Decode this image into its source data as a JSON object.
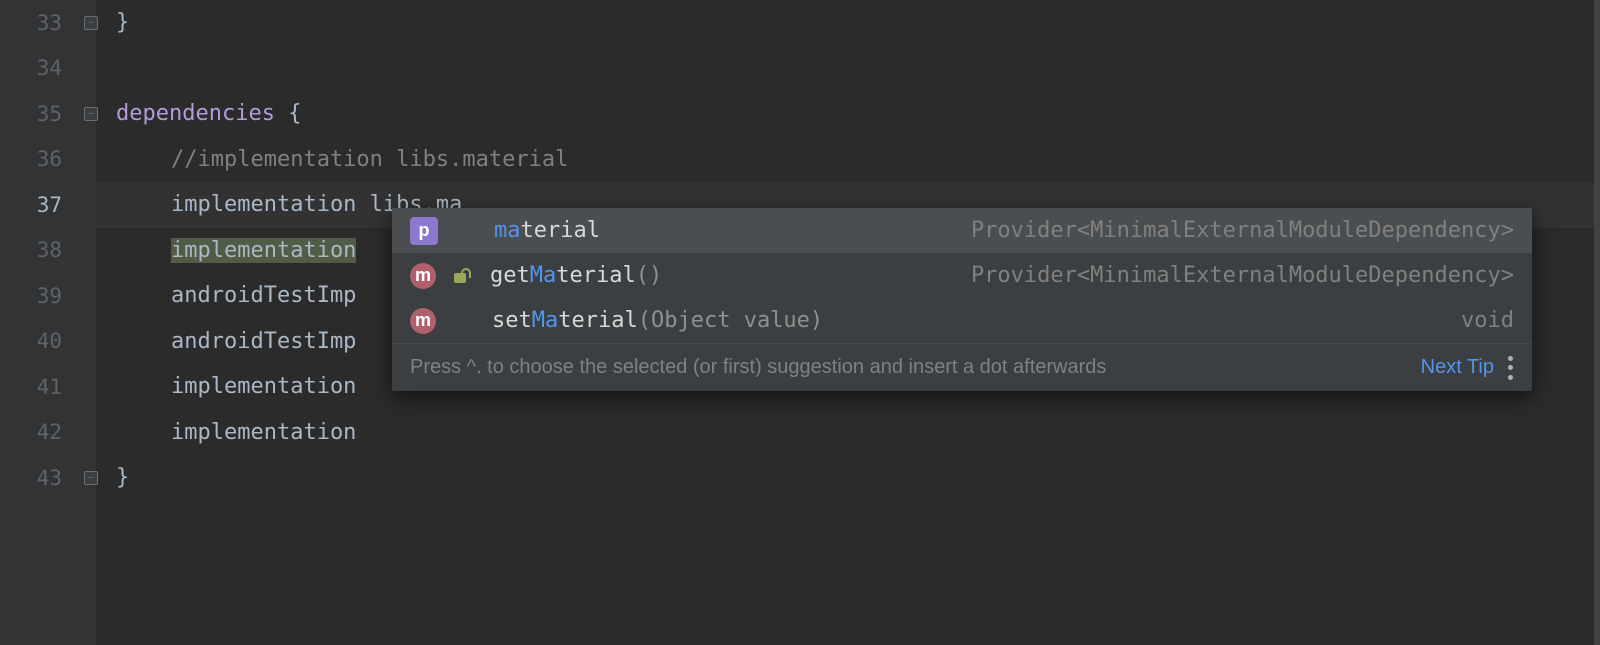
{
  "gutter": {
    "start": 33,
    "count": 11,
    "current": 37
  },
  "code": {
    "l33": {
      "brace": "}",
      "fold": "end"
    },
    "l34": {
      "empty": ""
    },
    "l35": {
      "block": "dependencies",
      "brace": " {",
      "fold": "start"
    },
    "l36": {
      "comment": "//implementation libs.material"
    },
    "l37": {
      "kw": "implementation",
      "arg": " libs.ma"
    },
    "l38": {
      "kw": "implementation"
    },
    "l39": {
      "kw": "androidTestImp"
    },
    "l40": {
      "kw": "androidTestImp"
    },
    "l41": {
      "kw": "implementation"
    },
    "l42": {
      "kw": "implementation"
    },
    "l43": {
      "brace": "}",
      "fold": "end"
    }
  },
  "popup": {
    "rows": [
      {
        "icon": "p",
        "match": "ma",
        "rest": "terial",
        "type": "Provider<MinimalExternalModuleDependency>",
        "selected": true
      },
      {
        "icon": "m",
        "lock": true,
        "pre": "get",
        "match": "Ma",
        "rest": "terial",
        "post": "()",
        "type": "Provider<MinimalExternalModuleDependency>"
      },
      {
        "icon": "m",
        "pre": "set",
        "match": "Ma",
        "rest": "terial",
        "post_dim": "(Object value)",
        "type": "void"
      }
    ],
    "tip": "Press ^. to choose the selected (or first) suggestion and insert a dot afterwards",
    "next": "Next Tip"
  }
}
